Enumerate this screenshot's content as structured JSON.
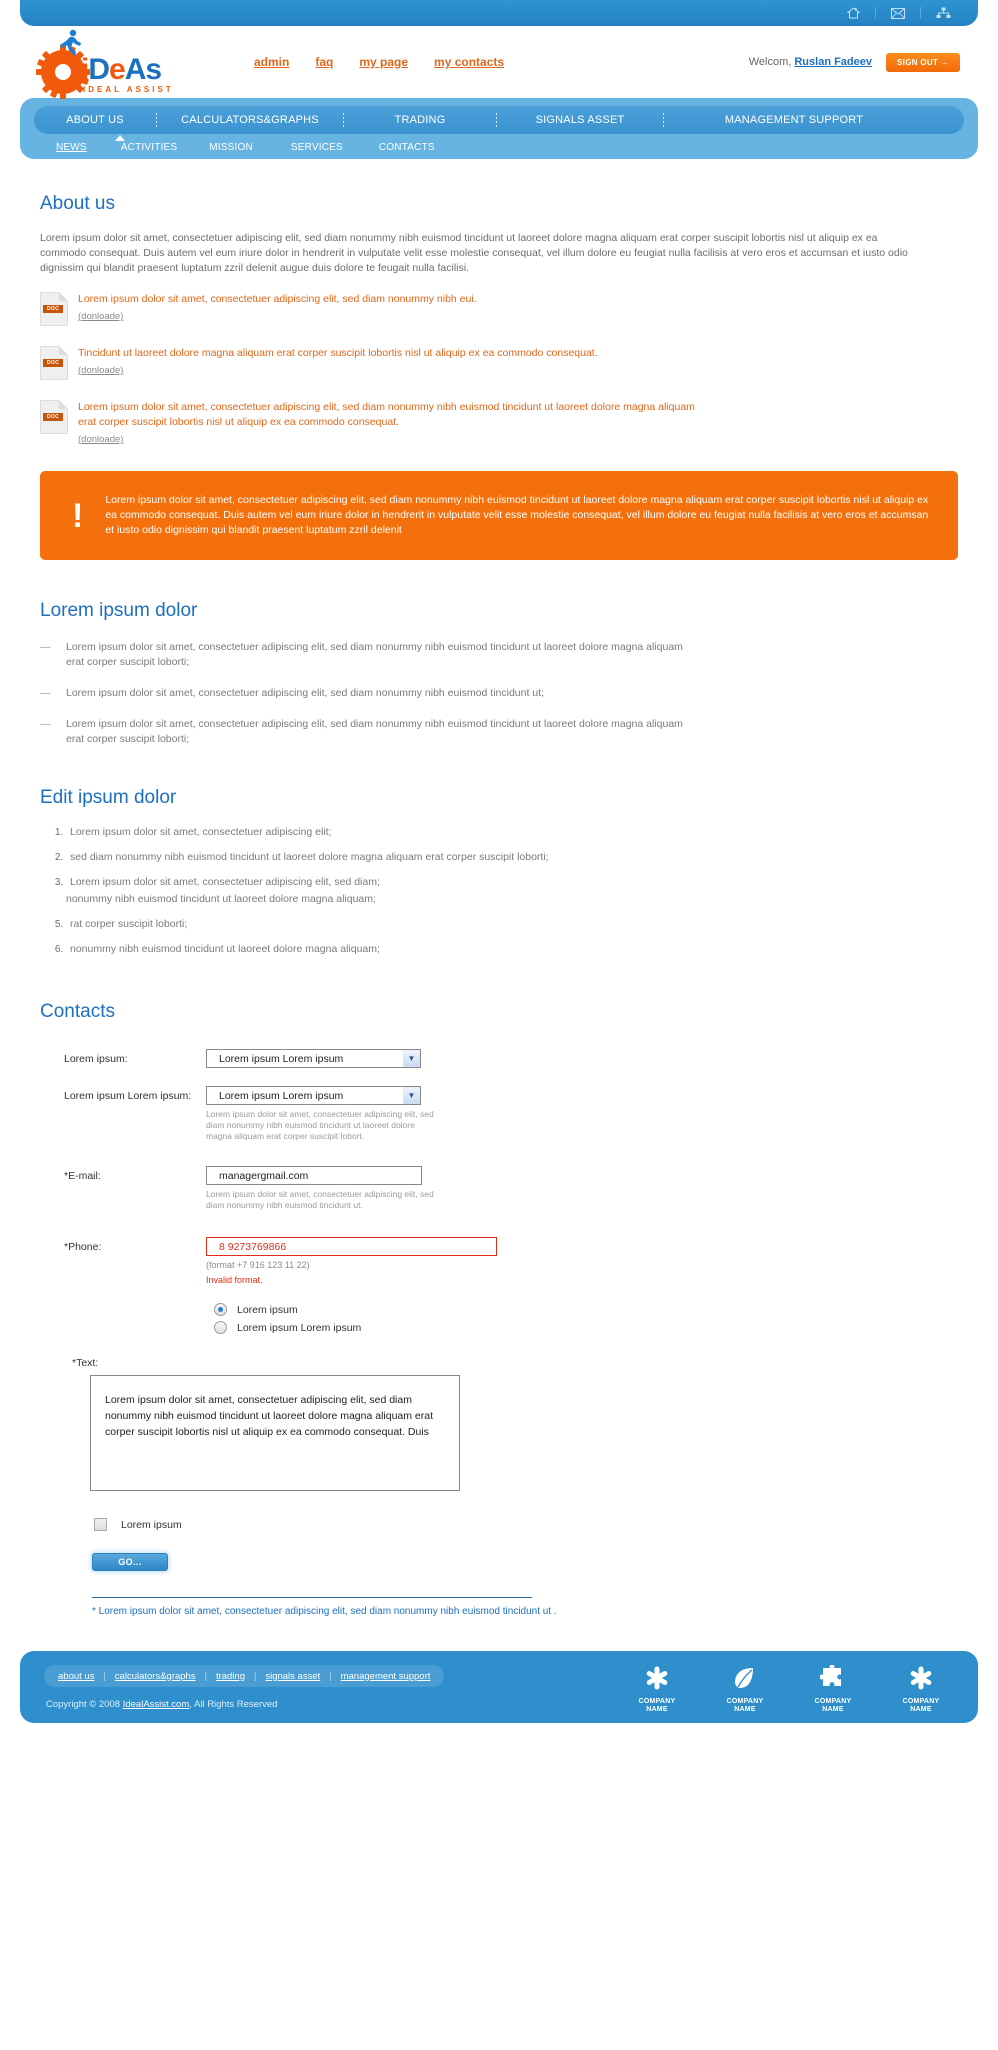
{
  "topbar": {
    "icons": [
      {
        "name": "home-icon",
        "glyph": "⌂"
      },
      {
        "name": "mail-icon",
        "glyph": "✉"
      },
      {
        "name": "sitemap-icon",
        "glyph": "⛁"
      }
    ]
  },
  "logo": {
    "word_i": "i",
    "word_d": "D",
    "word_e": "e",
    "word_a": "A",
    "word_s": "s",
    "tagline": "IDEAL ASSIST"
  },
  "header": {
    "nav": [
      {
        "label": "admin"
      },
      {
        "label": "faq"
      },
      {
        "label": "my page"
      },
      {
        "label": "my contacts"
      }
    ],
    "welcome_prefix": "Welcom,",
    "user_name": "Ruslan Fadeev",
    "signout_label": "SIGN OUT →"
  },
  "nav": {
    "main": [
      {
        "label": "ABOUT US",
        "active": true
      },
      {
        "label": "CALCULATORS&GRAPHS",
        "active": false
      },
      {
        "label": "TRADING",
        "active": false
      },
      {
        "label": "SIGNALS ASSET",
        "active": false
      },
      {
        "label": "MANAGEMENT SUPPORT",
        "active": false
      }
    ],
    "sub": [
      {
        "label": "NEWS",
        "active": true
      },
      {
        "label": "ACTIVITIES",
        "active": false
      },
      {
        "label": "MISSION",
        "active": false
      },
      {
        "label": "SERVICES",
        "active": false
      },
      {
        "label": "CONTACTS",
        "active": false
      }
    ]
  },
  "about": {
    "title": "About us",
    "paragraph": "Lorem ipsum dolor sit amet, consectetuer adipiscing elit, sed diam nonummy nibh euismod tincidunt ut laoreet dolore magna aliquam erat corper suscipit lobortis nisl ut aliquip ex ea commodo consequat. Duis autem vel eum iriure dolor in hendrerit in vulputate velit esse molestie consequat, vel illum dolore eu feugiat nulla facilisis at vero eros et accumsan et iusto odio dignissim qui blandit praesent luptatum zzril delenit augue duis dolore te feugait nulla facilisi."
  },
  "documents": {
    "download_label": "(donloade)",
    "icon_label": "DOC",
    "items": [
      {
        "text": "Lorem ipsum dolor sit amet, consectetuer adipiscing elit, sed diam nonummy nibh eui."
      },
      {
        "text": "Tincidunt ut laoreet dolore magna aliquam erat corper suscipit lobortis nisl ut aliquip ex ea commodo consequat."
      },
      {
        "text": "Lorem ipsum dolor sit amet, consectetuer adipiscing elit, sed diam nonummy nibh euismod tincidunt ut laoreet dolore magna aliquam erat corper suscipit lobortis nisl ut aliquip ex ea commodo consequat."
      }
    ]
  },
  "alert": {
    "icon": "!",
    "text": "Lorem ipsum dolor sit amet, consectetuer adipiscing elit, sed diam nonummy nibh euismod tincidunt ut laoreet dolore magna aliquam erat corper suscipit lobortis nisl ut aliquip ex ea commodo consequat. Duis autem vel eum iriure dolor in hendrerit in vulputate velit esse molestie consequat, vel illum dolore eu feugiat nulla facilisis at vero eros et accumsan et iusto odio dignissim qui blandit praesent luptatum zzril delenit",
    "bg_color": "#f4700d"
  },
  "lorem_section": {
    "title": "Lorem ipsum dolor",
    "items": [
      "Lorem ipsum dolor sit amet, consectetuer adipiscing elit, sed diam nonummy nibh euismod tincidunt ut laoreet dolore magna aliquam erat corper suscipit loborti;",
      "Lorem ipsum dolor sit amet, consectetuer adipiscing elit, sed diam nonummy nibh euismod tincidunt ut;",
      "Lorem ipsum dolor sit amet, consectetuer adipiscing elit, sed diam nonummy nibh euismod tincidunt ut laoreet dolore magna aliquam erat corper suscipit loborti;"
    ]
  },
  "edit_section": {
    "title": "Edit ipsum dolor",
    "items": [
      "Lorem ipsum dolor sit amet, consectetuer adipiscing elit;",
      "sed diam nonummy nibh euismod tincidunt ut laoreet dolore magna aliquam erat corper suscipit loborti;",
      "Lorem ipsum dolor sit amet, consectetuer adipiscing elit, sed diam;",
      "nonummy nibh euismod tincidunt ut laoreet dolore magna aliquam;",
      "rat corper suscipit loborti;",
      "nonummy nibh euismod tincidunt ut laoreet dolore magna aliquam;"
    ]
  },
  "contacts": {
    "title": "Contacts",
    "select1": {
      "label": "Lorem ipsum:",
      "value": "Lorem ipsum Lorem ipsum",
      "options": [
        "Lorem ipsum Lorem ipsum"
      ]
    },
    "select2": {
      "label": "Lorem ipsum Lorem ipsum:",
      "value": "Lorem ipsum Lorem ipsum",
      "options": [
        "Lorem ipsum Lorem ipsum"
      ],
      "hint": "Lorem ipsum dolor sit amet, consectetuer adipiscing elit, sed diam nonummy nibh euismod tincidunt ut laoreet dolore magna aliquam erat corper suscipit lobort."
    },
    "email": {
      "label": "*E-mail:",
      "value": "managergmail.com",
      "hint": "Lorem ipsum dolor sit amet, consectetuer adipiscing elit, sed diam nonummy nibh euismod tincidunt ut."
    },
    "phone": {
      "label": "*Phone:",
      "value": "8 9273769866",
      "format_hint": "(format +7 916 123 11 22)",
      "error": "Invalid format.",
      "error_color": "#e02c1a"
    },
    "radios": [
      {
        "label": "Lorem ipsum",
        "selected": true
      },
      {
        "label": "Lorem ipsum Lorem ipsum",
        "selected": false
      }
    ],
    "textarea": {
      "label": "*Text:",
      "value": "Lorem ipsum dolor sit amet, consectetuer adipiscing elit, sed diam nonummy nibh euismod tincidunt ut laoreet dolore magna aliquam erat corper suscipit lobortis nisl ut aliquip ex ea commodo consequat. Duis"
    },
    "checkbox": {
      "label": "Lorem ipsum",
      "checked": false
    },
    "submit_label": "GO...",
    "footnote": "* Lorem ipsum dolor sit amet, consectetuer adipiscing elit, sed diam nonummy nibh euismod tincidunt ut ."
  },
  "footer": {
    "links": [
      {
        "label": "about us"
      },
      {
        "label": "calculators&graphs"
      },
      {
        "label": "trading"
      },
      {
        "label": "signals asset"
      },
      {
        "label": "management support"
      }
    ],
    "divider": "|",
    "copyright_prefix": "Copyright © 2008",
    "copyright_link": "IdealAssist.com",
    "copyright_suffix": ", All Rights Reserved",
    "partners": [
      {
        "icon": "asterisk-icon",
        "name": "COMPANY NAME"
      },
      {
        "icon": "leaf-icon",
        "name": "COMPANY NAME"
      },
      {
        "icon": "puzzle-icon",
        "name": "COMPANY NAME"
      },
      {
        "icon": "asterisk-icon",
        "name": "COMPANY NAME"
      }
    ]
  }
}
